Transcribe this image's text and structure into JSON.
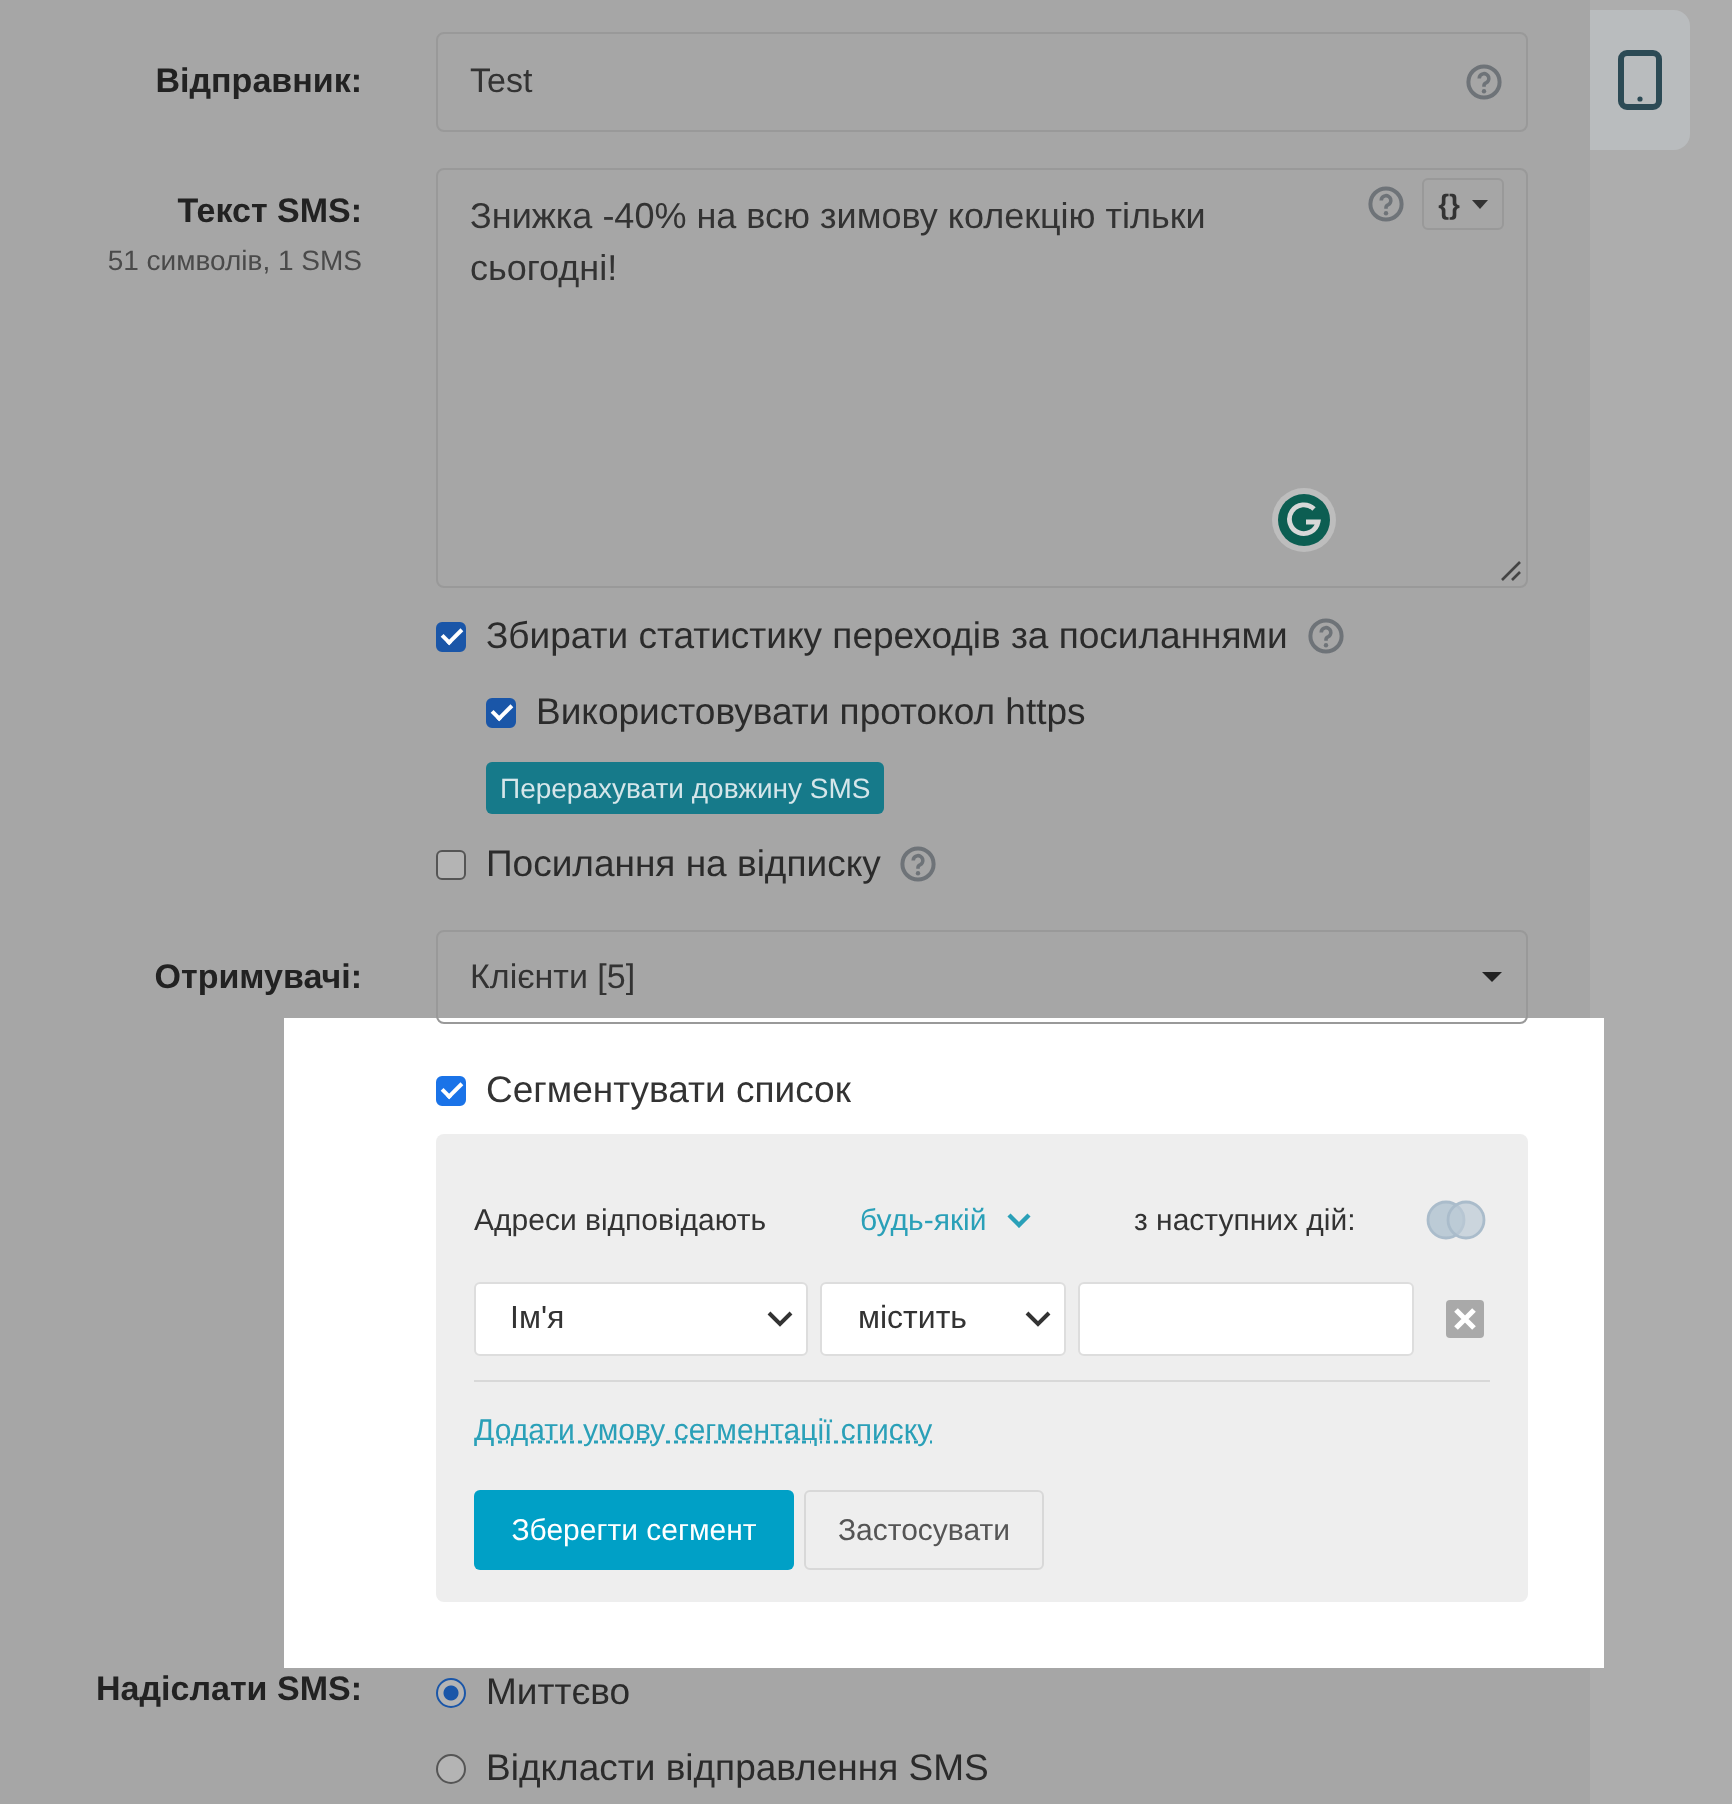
{
  "sender": {
    "label": "Відправник:",
    "value": "Test",
    "help": true
  },
  "sms_text": {
    "label": "Текст SMS:",
    "counter": "51 символів, 1 SMS",
    "value": "Знижка -40% на всю зимову колекцію тільки сьогодні!",
    "variables_button": "{}"
  },
  "options": [
    {
      "kind": "checkbox",
      "label": "Збирати статистику переходів за посиланнями",
      "checked": true,
      "help": true,
      "indented": false
    },
    {
      "kind": "checkbox",
      "label": "Використовувати протокол https",
      "checked": true,
      "help": false,
      "indented": true
    },
    {
      "kind": "button",
      "label": "Перерахувати довжину SMS"
    },
    {
      "kind": "checkbox",
      "label": "Посилання на відписку",
      "checked": false,
      "help": true,
      "indented": false
    }
  ],
  "recipients": {
    "label": "Отримувачі:",
    "value": "Клієнти [5]"
  },
  "segment": {
    "label": "Сегментувати список",
    "checked": true,
    "match_label": "Адреси відповідають",
    "match_value": "будь-якій",
    "match_suffix": "з наступних дій:",
    "conditions": [
      {
        "field": "Ім'я",
        "operator": "містить"
      }
    ],
    "add_link": "Додати умову сегментації списку",
    "save_button": "Зберегти сегмент",
    "apply_button": "Застосувати"
  },
  "send": {
    "label": "Надіслати SMS:",
    "options": [
      {
        "label": "Миттєво",
        "selected": true
      },
      {
        "label": "Відкласти відправлення SMS",
        "selected": false
      }
    ]
  }
}
